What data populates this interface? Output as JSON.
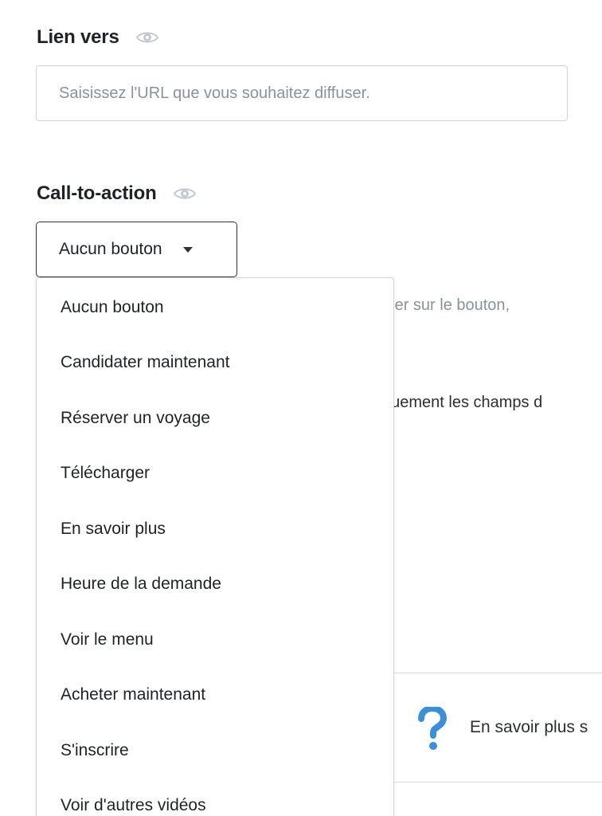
{
  "link_section": {
    "label": "Lien vers",
    "visibility_icon": "eye-icon",
    "input": {
      "value": "",
      "placeholder": "Saisissez l'URL que vous souhaitez diffuser."
    }
  },
  "cta_section": {
    "label": "Call-to-action",
    "visibility_icon": "eye-icon",
    "select": {
      "selected": "Aucun bouton",
      "caret_icon": "caret-down-icon"
    },
    "options": [
      "Aucun bouton",
      "Candidater maintenant",
      "Réserver un voyage",
      "Télécharger",
      "En savoir plus",
      "Heure de la demande",
      "Voir le menu",
      "Acheter maintenant",
      "S'inscrire",
      "Voir d'autres vidéos"
    ]
  },
  "background": {
    "help_text_1": "icher sur le bouton,",
    "help_text_2": "tiquement les champs d",
    "info_box": {
      "icon": "question-icon",
      "text": "En savoir plus s"
    }
  },
  "colors": {
    "accent": "#3a8fd6",
    "muted_text": "#8a939c",
    "border": "#cfd5db",
    "eye_icon": "#c4cad0"
  }
}
